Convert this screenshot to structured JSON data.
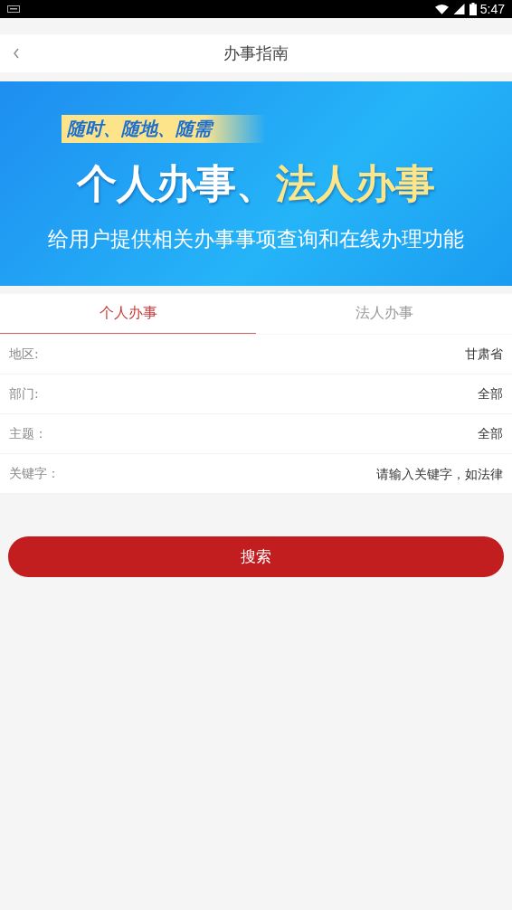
{
  "status_bar": {
    "time": "5:47"
  },
  "header": {
    "title": "办事指南"
  },
  "banner": {
    "tagline": "随时、随地、随需",
    "headline_part1": "个人办事、",
    "headline_part2": "法人办事",
    "subtitle": "给用户提供相关办事事项查询和在线办理功能"
  },
  "tabs": [
    {
      "label": "个人办事",
      "selected": true
    },
    {
      "label": "法人办事",
      "selected": false
    }
  ],
  "form_rows": [
    {
      "kind": "select",
      "label": "地区:",
      "value": "甘肃省"
    },
    {
      "kind": "select",
      "label": "部门:",
      "value": "全部"
    },
    {
      "kind": "select",
      "label": "主题：",
      "value": "全部"
    },
    {
      "kind": "input",
      "label": "关键字：",
      "placeholder": "请输入关键字，如法律"
    }
  ],
  "search_button": {
    "label": "搜索"
  }
}
